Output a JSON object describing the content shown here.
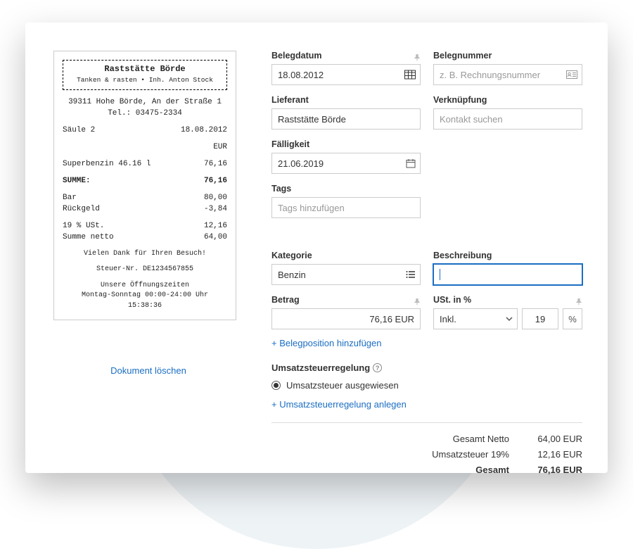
{
  "receipt": {
    "title": "Raststätte Börde",
    "subtitle": "Tanken & rasten • Inh. Anton Stock",
    "addr1": "39311 Hohe Börde, An der Straße 1",
    "addr2": "Tel.: 03475-2334",
    "pump": "Säule 2",
    "date": "18.08.2012",
    "currency": "EUR",
    "fuel_line_label": "Superbenzin 46.16 l",
    "fuel_line_value": "76,16",
    "sum_label": "SUMME:",
    "sum_value": "76,16",
    "cash_label": "Bar",
    "cash_value": "80,00",
    "change_label": "Rückgeld",
    "change_value": "-3,84",
    "vat_label": "19 % USt.",
    "vat_value": "12,16",
    "net_label": "Summe netto",
    "net_value": "64,00",
    "thanks": "Vielen Dank für Ihren Besuch!",
    "tax_no": "Steuer-Nr. DE1234567855",
    "hours_title": "Unsere Öffnungszeiten",
    "hours_line": "Montag-Sonntag 00:00-24:00 Uhr",
    "time": "15:38:36"
  },
  "actions": {
    "delete_doc": "Dokument löschen",
    "add_position": "+ Belegposition hinzufügen",
    "add_ust_rule": "+ Umsatzsteuerregelung anlegen"
  },
  "form": {
    "doc_date": {
      "label": "Belegdatum",
      "value": "18.08.2012"
    },
    "doc_number": {
      "label": "Belegnummer",
      "placeholder": "z. B. Rechnungsnummer"
    },
    "supplier": {
      "label": "Lieferant",
      "value": "Raststätte Börde"
    },
    "link": {
      "label": "Verknüpfung",
      "placeholder": "Kontakt suchen"
    },
    "due": {
      "label": "Fälligkeit",
      "value": "21.06.2019"
    },
    "tags": {
      "label": "Tags",
      "placeholder": "Tags hinzufügen"
    },
    "category": {
      "label": "Kategorie",
      "value": "Benzin"
    },
    "description": {
      "label": "Beschreibung"
    },
    "amount": {
      "label": "Betrag",
      "value": "76,16 EUR"
    },
    "vat": {
      "label": "USt. in %",
      "inkl": "Inkl.",
      "rate": "19",
      "pct": "%"
    }
  },
  "ust": {
    "title": "Umsatzsteuerregelung",
    "option": "Umsatzsteuer ausgewiesen"
  },
  "totals": {
    "net_label": "Gesamt Netto",
    "net_value": "64,00 EUR",
    "vat_label": "Umsatzsteuer 19%",
    "vat_value": "12,16 EUR",
    "gross_label": "Gesamt",
    "gross_value": "76,16 EUR"
  }
}
